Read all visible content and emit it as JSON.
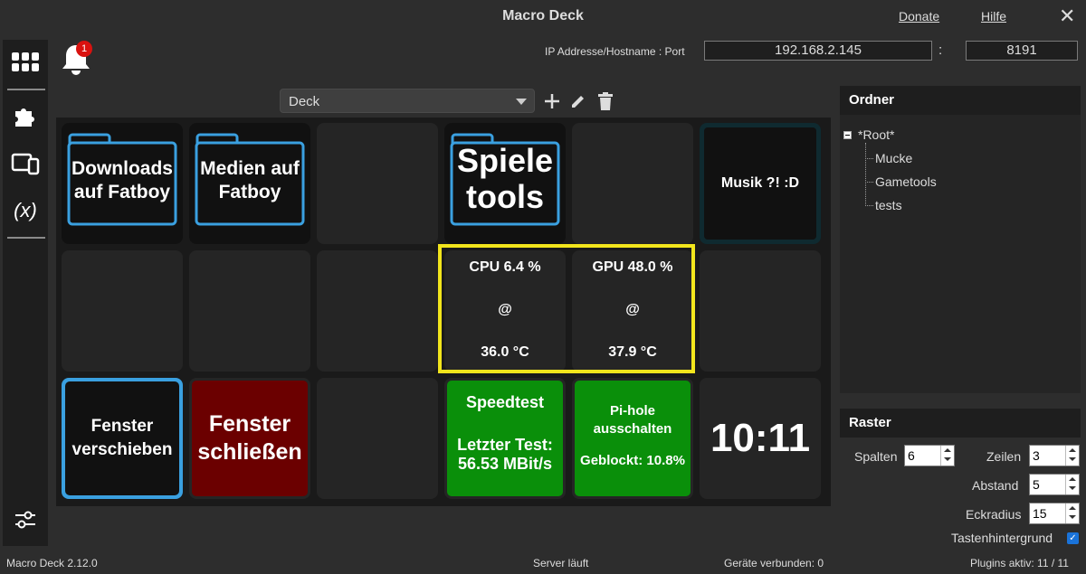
{
  "window": {
    "title": "Macro Deck",
    "donate": "Donate",
    "help": "Hilfe",
    "close": "✕"
  },
  "notifications": {
    "count": "1"
  },
  "connection": {
    "label": "IP Addresse/Hostname : Port",
    "ip": "192.168.2.145",
    "separator": ":",
    "port": "8191"
  },
  "deck": {
    "profile": "Deck",
    "buttons": {
      "b1": {
        "line1": "Downloads",
        "line2": "auf Fatboy"
      },
      "b2": {
        "line1": "Medien auf",
        "line2": "Fatboy"
      },
      "b4": {
        "line1": "Spiele",
        "line2": "tools"
      },
      "b6": {
        "text": "Musik ?! :D"
      },
      "cpu": {
        "line1": "CPU 6.4 %",
        "line2": "@",
        "line3": "36.0 °C"
      },
      "gpu": {
        "line1": "GPU 48.0 %",
        "line2": "@",
        "line3": "37.9 °C"
      },
      "b13": {
        "line1": "Fenster",
        "line2": "verschieben"
      },
      "b14": {
        "line1": "Fenster",
        "line2": "schließen"
      },
      "speedtest": {
        "line1": "Speedtest",
        "line2": "Letzter Test:",
        "line3": "56.53 MBit/s"
      },
      "pihole": {
        "line1": "Pi-hole",
        "line2": "ausschalten",
        "line3": "Geblockt: 10.8%"
      },
      "clock": {
        "text": "10:11"
      }
    }
  },
  "folders": {
    "title": "Ordner",
    "root": "*Root*",
    "children": [
      "Mucke",
      "Gametools",
      "tests"
    ]
  },
  "grid": {
    "title": "Raster",
    "columns_label": "Spalten",
    "columns": "6",
    "rows_label": "Zeilen",
    "rows": "3",
    "spacing_label": "Abstand",
    "spacing": "5",
    "radius_label": "Eckradius",
    "radius": "15",
    "background_label": "Tastenhintergrund",
    "background_checked": true
  },
  "status": {
    "version": "Macro Deck 2.12.0",
    "server": "Server läuft",
    "devices": "Geräte verbunden: 0",
    "plugins": "Plugins aktiv: 11 / 11"
  },
  "colors": {
    "accent_blue": "#3aa0e0",
    "green": "#0a8f0a",
    "dark_red": "#6b0000",
    "highlight": "#f2e51c",
    "badge": "#d9120f"
  }
}
